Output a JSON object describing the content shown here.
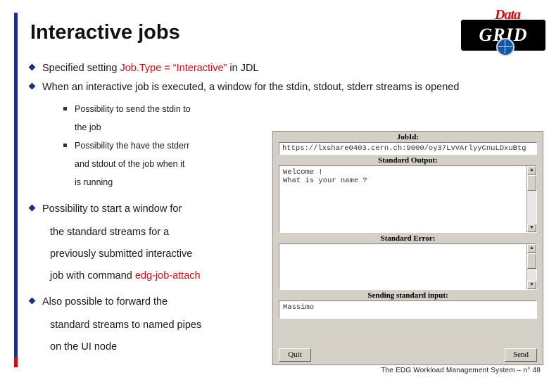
{
  "slide": {
    "title": "Interactive jobs",
    "footer": "The EDG Workload Management System –  n° 48"
  },
  "logo": {
    "word_top": "Data",
    "word_main": "GRID",
    "globe_icon": "globe-icon"
  },
  "bullets": {
    "b1_pre": "Specified setting ",
    "b1_code": "Job.Type = “Interactive”",
    "b1_post": " in JDL",
    "b2": "When an interactive job is executed, a window for the stdin, stdout, stderr streams is opened",
    "sub1_line1": "Possibility to send the stdin to",
    "sub1_line2": "the job",
    "sub2_line1": "Possibility the have the stderr",
    "sub2_line2": "and stdout of the job when it",
    "sub2_line3": "is running",
    "b3_line1": "Possibility to start a window for",
    "b3_line2": "the standard streams for a",
    "b3_line3": "previously submitted interactive",
    "b3_line4_pre": "job with command ",
    "b3_line4_code": "edg-job-attach",
    "b4_line1": "Also possible to forward the",
    "b4_line2": "standard streams to named pipes",
    "b4_line3": "on the UI node"
  },
  "screenshot": {
    "jobid_label": "JobId:",
    "jobid_value": "https://lxshare0403.cern.ch:9000/oy37LvVArlyyCnuLDxuBtg",
    "stdout_label": "Standard Output:",
    "stdout_line1": "Welcome !",
    "stdout_line2": "What is your name ?",
    "stderr_label": "Standard Error:",
    "stdin_label": "Sending standard input:",
    "stdin_value": "Massimo",
    "quit_button": "Quit",
    "send_button": "Send",
    "scroll_up_icon": "scroll-up-arrow-icon",
    "scroll_down_icon": "scroll-down-arrow-icon"
  },
  "colors": {
    "accent_red": "#c41019",
    "accent_blue": "#1b2f8a"
  }
}
